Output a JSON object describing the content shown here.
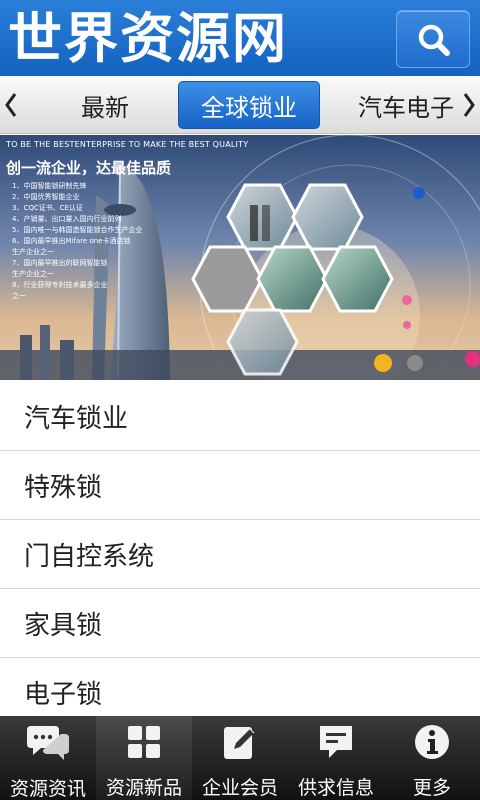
{
  "header": {
    "logo_text": "世界资源网",
    "search_icon": "search-icon"
  },
  "tabs": {
    "prev_icon": "chevron-left-icon",
    "next_icon": "chevron-right-icon",
    "items": [
      {
        "label": "最新",
        "active": false
      },
      {
        "label": "全球锁业",
        "active": true
      },
      {
        "label": "汽车电子",
        "active": false
      }
    ]
  },
  "banner": {
    "top_line": "TO BE THE BESTENTERPRISE TO MAKE THE BEST QUALITY",
    "slogan": "创一流企业，达最佳品质",
    "points": [
      "1、中国智能锁研制先锋",
      "2、中国优秀智能企业",
      "3、CQC证书、CE认证",
      "4、产销量、出口量入国内行业前列",
      "5、国内唯一与韩国造智能锁合作生产企业",
      "6、国内最早推出Mifare one卡酒店锁",
      "    生产企业之一",
      "7、国内最早推出的联网智能锁",
      "    生产企业之一",
      "8、行业获得专利技术最多企业",
      "    之一"
    ]
  },
  "list": [
    "汽车锁业",
    "特殊锁",
    "门自控系统",
    "家具锁",
    "电子锁"
  ],
  "bottom_nav": [
    {
      "label": "资源资讯",
      "icon": "chat-bubbles-icon",
      "active": false
    },
    {
      "label": "资源新品",
      "icon": "grid-icon",
      "active": true
    },
    {
      "label": "企业会员",
      "icon": "edit-note-icon",
      "active": false
    },
    {
      "label": "供求信息",
      "icon": "message-icon",
      "active": false
    },
    {
      "label": "更多",
      "icon": "info-icon",
      "active": false
    }
  ],
  "colors": {
    "header_blue": "#1a6bc9",
    "tab_active": "#2a7bd9",
    "nav_bg": "#1e1e1e"
  }
}
